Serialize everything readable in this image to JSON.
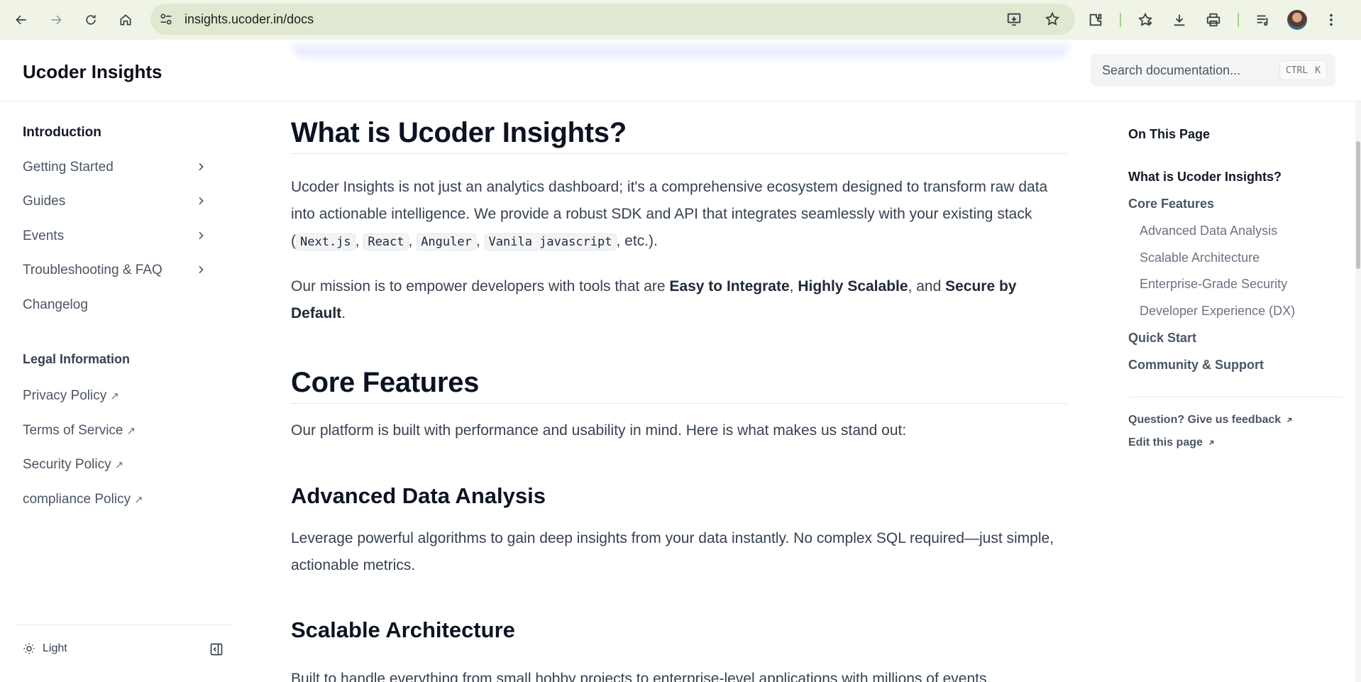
{
  "browser": {
    "url": "insights.ucoder.in/docs"
  },
  "header": {
    "brand": "Ucoder Insights",
    "search_placeholder": "Search documentation...",
    "shortcut_ctrl": "CTRL",
    "shortcut_key": "K"
  },
  "sidebar": {
    "items": [
      {
        "label": "Introduction",
        "active": true,
        "has_children": false
      },
      {
        "label": "Getting Started",
        "has_children": true
      },
      {
        "label": "Guides",
        "has_children": true
      },
      {
        "label": "Events",
        "has_children": true
      },
      {
        "label": "Troubleshooting & FAQ",
        "has_children": true
      },
      {
        "label": "Changelog",
        "has_children": false
      }
    ],
    "legal_heading": "Legal Information",
    "legal_items": [
      {
        "label": "Privacy Policy"
      },
      {
        "label": "Terms of Service"
      },
      {
        "label": "Security Policy"
      },
      {
        "label": "compliance Policy"
      }
    ],
    "external_mark": "↗",
    "theme_label": "Light"
  },
  "content": {
    "h1": "What is Ucoder Insights?",
    "intro_text_1": "Ucoder Insights is not just an analytics dashboard; it's a comprehensive ecosystem designed to transform raw data into actionable intelligence. We provide a robust SDK and API that integrates seamlessly with your existing stack (",
    "code_1": "Next.js",
    "code_2": "React",
    "code_3": "Anguler",
    "code_4": "Vanila javascript",
    "intro_text_end": ", etc.).",
    "mission_text_1": "Our mission is to empower developers with tools that are ",
    "mission_bold_1": "Easy to Integrate",
    "mission_bold_2": "Highly Scalable",
    "mission_and": ", and ",
    "mission_bold_3": "Secure by Default",
    "core_h1": "Core Features",
    "core_text": "Our platform is built with performance and usability in mind. Here is what makes us stand out:",
    "ada_h2": "Advanced Data Analysis",
    "ada_text": "Leverage powerful algorithms to gain deep insights from your data instantly. No complex SQL required—just simple, actionable metrics.",
    "sa_h2": "Scalable Architecture",
    "sa_text": "Built to handle everything from small hobby projects to enterprise-level applications with millions of events."
  },
  "toc": {
    "title": "On This Page",
    "items": [
      {
        "label": "What is Ucoder Insights?",
        "level": 1,
        "current": true
      },
      {
        "label": "Core Features",
        "level": 1
      },
      {
        "label": "Advanced Data Analysis",
        "level": 2
      },
      {
        "label": "Scalable Architecture",
        "level": 2
      },
      {
        "label": "Enterprise-Grade Security",
        "level": 2
      },
      {
        "label": "Developer Experience (DX)",
        "level": 2
      },
      {
        "label": "Quick Start",
        "level": 1
      },
      {
        "label": "Community & Support",
        "level": 1
      }
    ],
    "feedback_link": "Question? Give us feedback",
    "edit_link": "Edit this page"
  }
}
